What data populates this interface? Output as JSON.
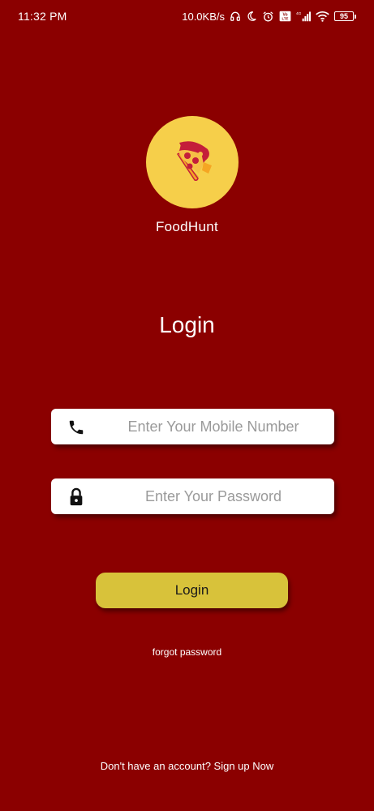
{
  "status_bar": {
    "time": "11:32 PM",
    "network_speed": "10.0KB/s",
    "battery_level": "95",
    "icons": [
      "headphones-icon",
      "moon-icon",
      "alarm-icon",
      "volte-icon",
      "4g-signal-icon",
      "wifi-icon",
      "battery-icon"
    ]
  },
  "app": {
    "logo_icon": "pizza-icon",
    "name": "FoodHunt"
  },
  "login": {
    "title": "Login",
    "mobile_placeholder": "Enter Your Mobile Number",
    "mobile_value": "",
    "mobile_icon": "phone-icon",
    "password_placeholder": "Enter Your Password",
    "password_value": "",
    "password_icon": "lock-icon",
    "button_label": "Login",
    "forgot_label": "forgot password",
    "signup_label": "Don't have an account? Sign up Now"
  },
  "colors": {
    "background": "#8b0000",
    "logo_circle": "#f6cf4a",
    "button": "#d8c23a",
    "field": "#ffffff"
  }
}
